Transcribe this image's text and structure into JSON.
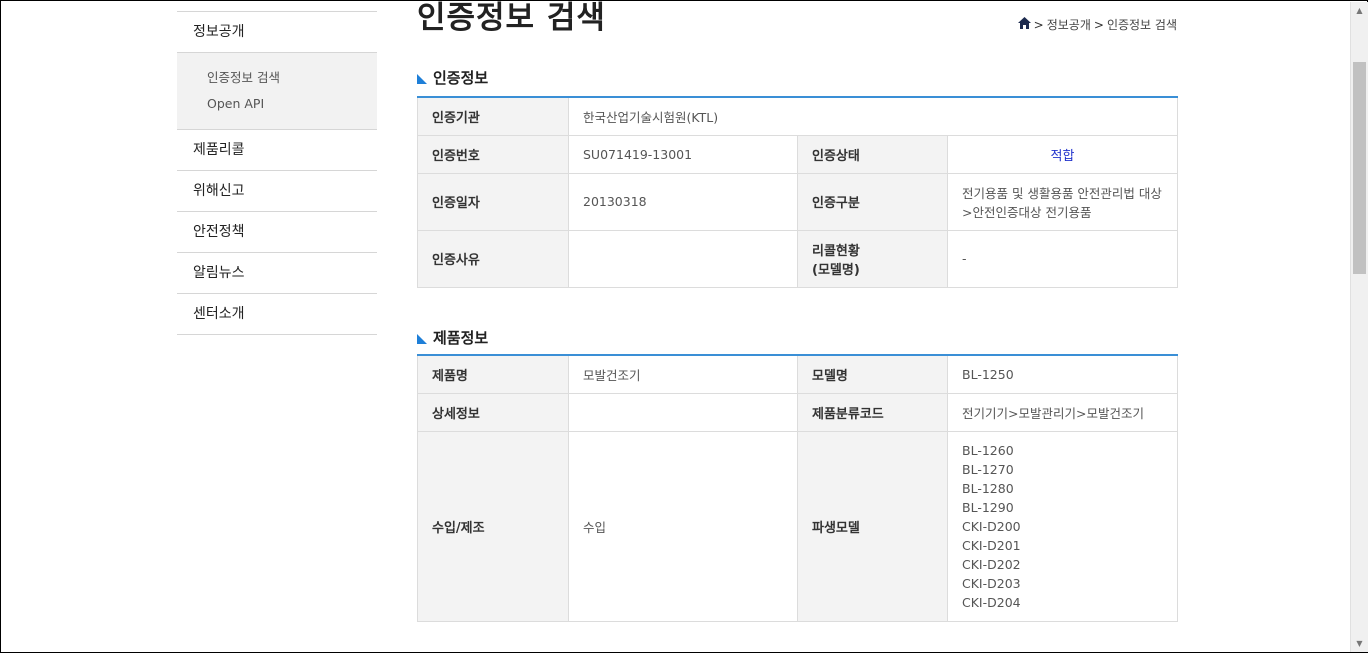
{
  "sidebar": {
    "items": [
      {
        "label": "정보공개"
      },
      {
        "label": "제품리콜"
      },
      {
        "label": "위해신고"
      },
      {
        "label": "안전정책"
      },
      {
        "label": "알림뉴스"
      },
      {
        "label": "센터소개"
      }
    ],
    "sub_items": [
      {
        "label": "인증정보 검색"
      },
      {
        "label": "Open API"
      }
    ]
  },
  "page": {
    "title": "인증정보 검색",
    "breadcrumb": [
      "정보공개",
      "인증정보 검색"
    ],
    "breadcrumb_sep": ">"
  },
  "cert": {
    "heading": "인증정보",
    "agency_label": "인증기관",
    "agency_value": "한국산업기술시험원(KTL)",
    "number_label": "인증번호",
    "number_value": "SU071419-13001",
    "status_label": "인증상태",
    "status_value": "적합",
    "date_label": "인증일자",
    "date_value": "20130318",
    "type_label": "인증구분",
    "type_value_line1": "전기용품 및 생활용품 안전관리법 대상",
    "type_value_line2": ">안전인증대상 전기용품",
    "reason_label": "인증사유",
    "reason_value": "",
    "recall_label_line1": "리콜현황",
    "recall_label_line2": "(모델명)",
    "recall_value": "-"
  },
  "product": {
    "heading": "제품정보",
    "name_label": "제품명",
    "name_value": "모발건조기",
    "model_label": "모델명",
    "model_value": "BL-1250",
    "detail_label": "상세정보",
    "detail_value": "",
    "class_label": "제품분류코드",
    "class_value": "전기기기>모발관리기>모발건조기",
    "import_label": "수입/제조",
    "import_value": "수입",
    "derived_label": "파생모델",
    "derived_models": [
      "BL-1260",
      "BL-1270",
      "BL-1280",
      "BL-1290",
      "CKI-D200",
      "CKI-D201",
      "CKI-D202",
      "CKI-D203",
      "CKI-D204"
    ]
  },
  "colors": {
    "accent": "#3a8fd6",
    "status": "#2233cc",
    "header_bg": "#f3f3f3"
  }
}
